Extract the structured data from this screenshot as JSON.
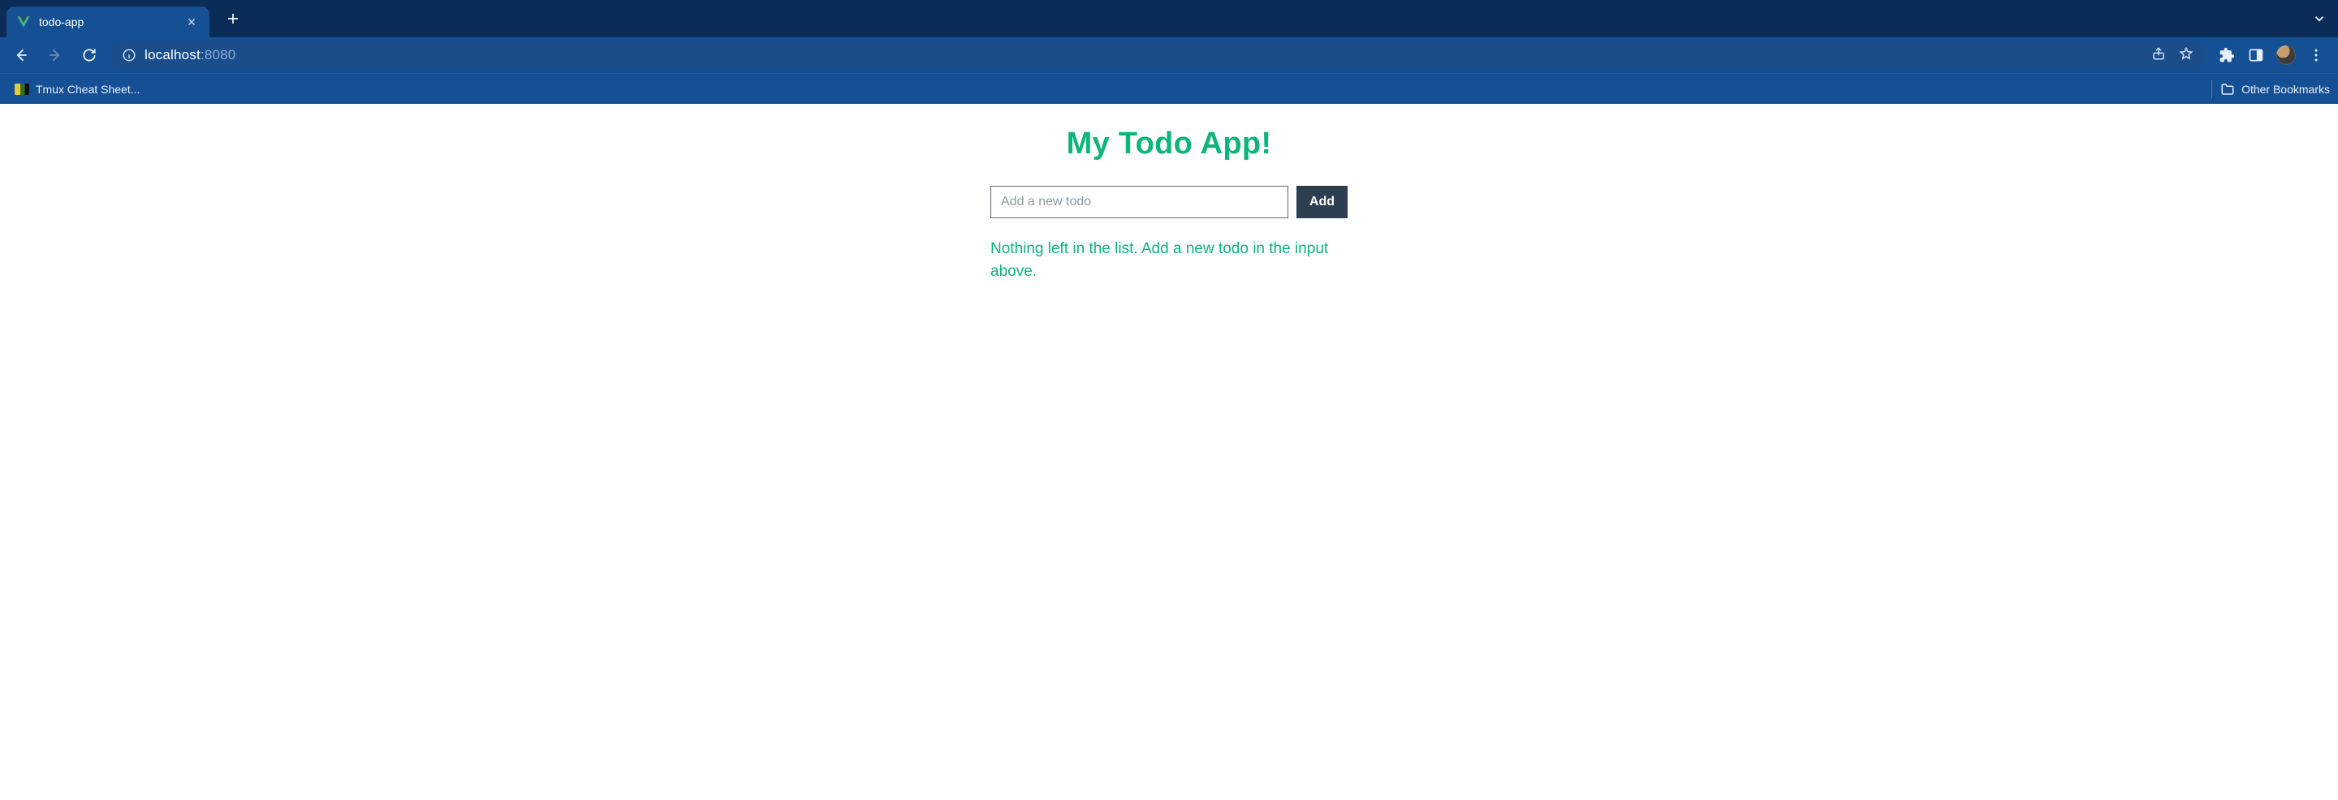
{
  "browser": {
    "tab": {
      "title": "todo-app"
    },
    "url": {
      "host": "localhost",
      "port": ":8080"
    },
    "bookmarks": {
      "item1": "Tmux Cheat Sheet...",
      "other": "Other Bookmarks"
    }
  },
  "app": {
    "heading": "My Todo App!",
    "input": {
      "placeholder": "Add a new todo",
      "value": ""
    },
    "add_button": "Add",
    "empty_message": "Nothing left in the list. Add a new todo in the input above."
  }
}
